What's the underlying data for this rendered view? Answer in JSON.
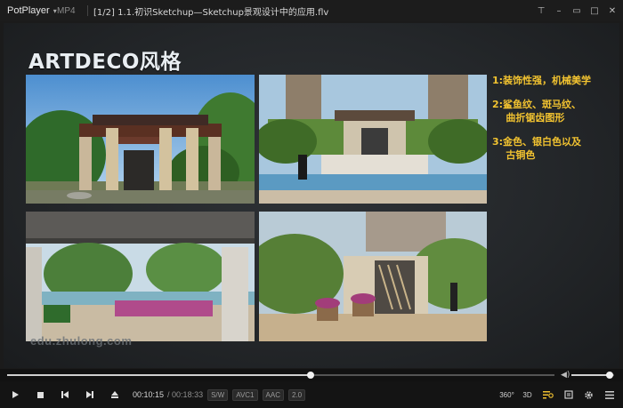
{
  "titlebar": {
    "app_name": "PotPlayer",
    "format": "MP4",
    "file_title": "[1/2] 1.1.初识Sketchup—Sketchup景观设计中的应用.flv",
    "controls": [
      "pin-icon",
      "minimize-icon",
      "restore-icon",
      "maximize-icon",
      "close-icon"
    ]
  },
  "slide": {
    "title": "ARTDECO风格",
    "bullets": [
      [
        "1:装饰性强，机械美学"
      ],
      [
        "2:鲨鱼纹、斑马纹、",
        "    曲折锯齿图形"
      ],
      [
        "3:金色、银白色以及",
        "    古铜色"
      ]
    ],
    "watermark": "edu.zhulong.com",
    "colors": {
      "bullet": "#f2c330",
      "title": "#e9eef2"
    }
  },
  "seek": {
    "progress": 0.555,
    "volume": 0.9
  },
  "controls": {
    "time_current": "00:10:15",
    "time_total": "/ 00:18:33",
    "badges": [
      "S/W",
      "AVC1",
      "AAC",
      "2.0"
    ],
    "right_buttons": [
      "360°",
      "3D"
    ]
  }
}
